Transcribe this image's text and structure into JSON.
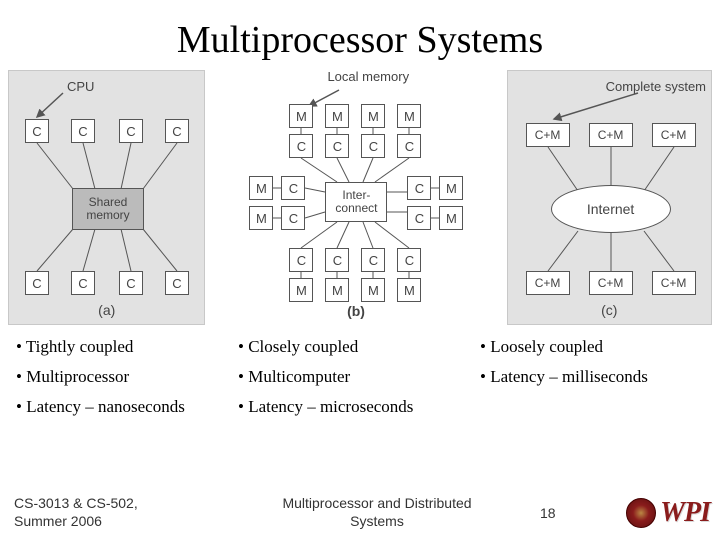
{
  "title": "Multiprocessor Systems",
  "diagrams": {
    "a": {
      "label": "(a)",
      "cpu_label": "CPU",
      "shared_mem": "Shared memory",
      "c": "C"
    },
    "b": {
      "label": "(b)",
      "local_mem_label": "Local memory",
      "interconnect": "Inter-connect",
      "m": "M",
      "c": "C"
    },
    "c": {
      "label": "(c)",
      "complete_label": "Complete system",
      "internet": "Internet",
      "cm": "C+M"
    }
  },
  "bullets": {
    "a": [
      "• Tightly coupled",
      "• Multiprocessor",
      "• Latency – nanoseconds"
    ],
    "b": [
      "• Closely coupled",
      "• Multicomputer",
      "• Latency – microseconds"
    ],
    "c": [
      "• Loosely coupled",
      "• Latency – milliseconds"
    ]
  },
  "footer": {
    "left_line1": "CS-3013 & CS-502,",
    "left_line2": "Summer 2006",
    "center_line1": "Multiprocessor and Distributed",
    "center_line2": "Systems",
    "page": "18",
    "logo_text": "WPI"
  }
}
